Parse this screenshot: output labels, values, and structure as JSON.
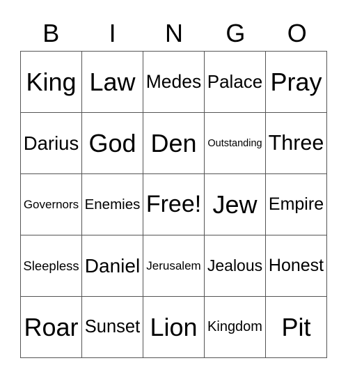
{
  "header": [
    "B",
    "I",
    "N",
    "G",
    "O"
  ],
  "cells": [
    [
      "King",
      "Law",
      "Medes",
      "Palace",
      "Pray"
    ],
    [
      "Darius",
      "God",
      "Den",
      "Outstanding",
      "Three"
    ],
    [
      "Governors",
      "Enemies",
      "Free!",
      "Jew",
      "Empire"
    ],
    [
      "Sleepless",
      "Daniel",
      "Jerusalem",
      "Jealous",
      "Honest"
    ],
    [
      "Roar",
      "Sunset",
      "Lion",
      "Kingdom",
      "Pit"
    ]
  ]
}
